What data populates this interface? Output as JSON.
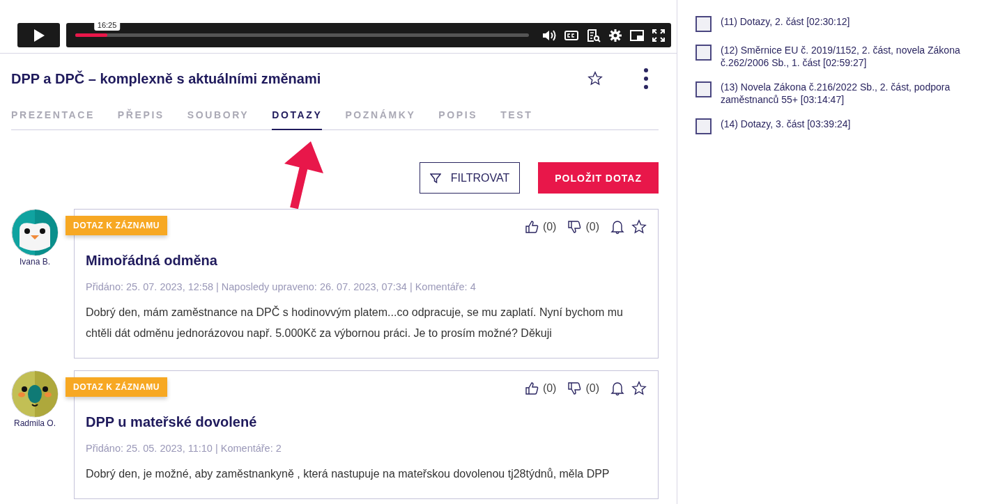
{
  "player": {
    "time_tooltip": "16:25",
    "level": 0.07
  },
  "title": "DPP a DPČ – komplexně s aktuálními změnami",
  "tabs": [
    {
      "label": "PREZENTACE",
      "selected": false
    },
    {
      "label": "PŘEPIS",
      "selected": false
    },
    {
      "label": "SOUBORY",
      "selected": false
    },
    {
      "label": "DOTAZY",
      "selected": true
    },
    {
      "label": "POZNÁMKY",
      "selected": false
    },
    {
      "label": "POPIS",
      "selected": false
    },
    {
      "label": "TEST",
      "selected": false
    }
  ],
  "buttons": {
    "filter": "FILTROVAT",
    "ask": "POLOŽIT DOTAZ"
  },
  "questions": [
    {
      "author": "Ivana B.",
      "kind": "penguin",
      "badge": "DOTAZ K ZÁZNAMU",
      "likes": "(0)",
      "dislikes": "(0)",
      "title": "Mimořádná odměna",
      "meta": "Přidáno: 25. 07. 2023, 12:58 | Naposledy upraveno: 26. 07. 2023, 07:34 | Komentáře: 4",
      "body": "Dobrý den, mám zaměstnance na DPČ s hodinovvým platem...co odpracuje, se mu zaplatí. Nyní bychom mu chtěli dát odměnu jednorázovou např. 5.000Kč za výbornou práci. Je to prosím možné? Děkuji"
    },
    {
      "author": "Radmila O.",
      "kind": "parrot",
      "badge": "DOTAZ K ZÁZNAMU",
      "likes": "(0)",
      "dislikes": "(0)",
      "title": "DPP u mateřské dovolené",
      "meta": "Přidáno: 25. 05. 2023, 11:10 | Komentáře: 2",
      "body": "Dobrý den, je možné, aby zaměstnankyně , která nastupuje na mateřskou dovolenou tj28týdnů, měla DPP"
    }
  ],
  "chapters": [
    {
      "label": "(11) Dotazy, 2. část [02:30:12]",
      "checked": false
    },
    {
      "label": "(12) Směrnice EU č. 2019/1152, 2. část, novela Zákona č.262/2006 Sb., 1. část [02:59:27]",
      "checked": false
    },
    {
      "label": "(13) Novela Zákona č.216/2022 Sb., 2. část, podpora zaměstnanců 55+ [03:14:47]",
      "checked": false
    },
    {
      "label": "(14) Dotazy, 3. část [03:39:24]",
      "checked": false
    }
  ]
}
